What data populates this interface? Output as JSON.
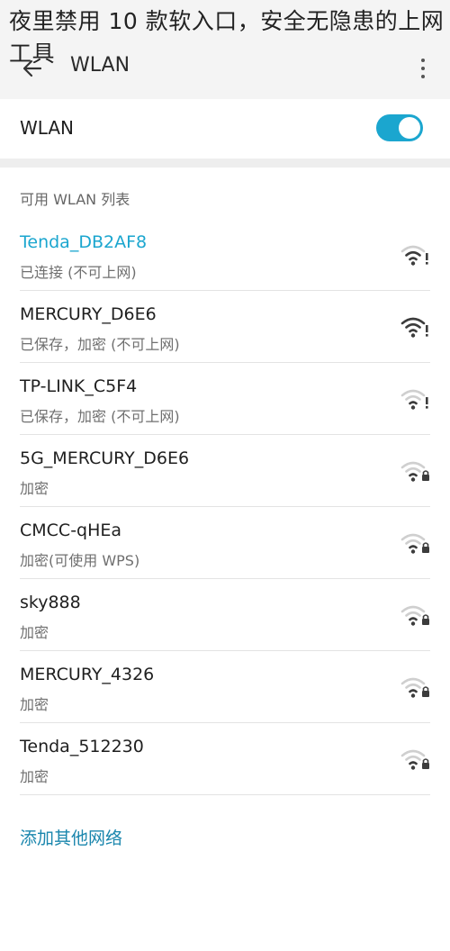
{
  "caption": {
    "line1": "夜里禁用 10 款软入口，安全无隐患的上网",
    "line2": "工具"
  },
  "appbar": {
    "title": "WLAN",
    "back_icon": "back-arrow-icon",
    "more_icon": "more-vert-icon"
  },
  "wlan_switch": {
    "label": "WLAN",
    "on": true
  },
  "section": {
    "title": "可用 WLAN 列表"
  },
  "networks": [
    {
      "name": "Tenda_DB2AF8",
      "status": "已连接 (不可上网)",
      "connected": true,
      "locked": false,
      "warning": true,
      "signal": "medium"
    },
    {
      "name": "MERCURY_D6E6",
      "status": "已保存，加密 (不可上网)",
      "connected": false,
      "locked": false,
      "warning": true,
      "signal": "strong"
    },
    {
      "name": "TP-LINK_C5F4",
      "status": "已保存，加密 (不可上网)",
      "connected": false,
      "locked": false,
      "warning": true,
      "signal": "weak"
    },
    {
      "name": "5G_MERCURY_D6E6",
      "status": "加密",
      "connected": false,
      "locked": true,
      "warning": false,
      "signal": "weak"
    },
    {
      "name": "CMCC-qHEa",
      "status": "加密(可使用 WPS)",
      "connected": false,
      "locked": true,
      "warning": false,
      "signal": "weak"
    },
    {
      "name": "sky888",
      "status": "加密",
      "connected": false,
      "locked": true,
      "warning": false,
      "signal": "weak"
    },
    {
      "name": "MERCURY_4326",
      "status": "加密",
      "connected": false,
      "locked": true,
      "warning": false,
      "signal": "weak"
    },
    {
      "name": "Tenda_512230",
      "status": "加密",
      "connected": false,
      "locked": true,
      "warning": false,
      "signal": "weak"
    }
  ],
  "add_network": {
    "label": "添加其他网络"
  },
  "colors": {
    "accent": "#1ba6cf",
    "link": "#1a86ad"
  }
}
